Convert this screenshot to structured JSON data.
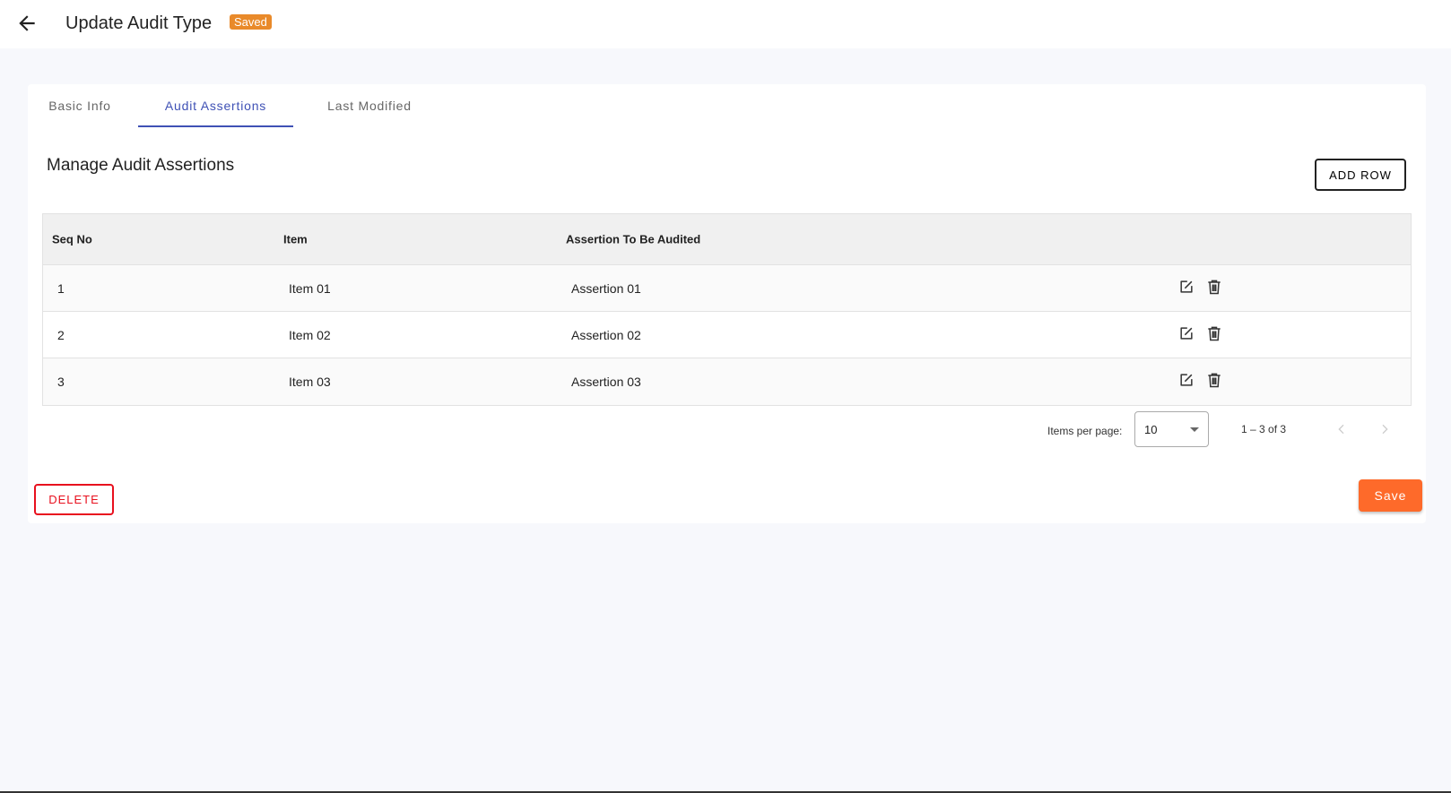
{
  "header": {
    "title": "Update Audit Type",
    "badge": "Saved"
  },
  "tabs": [
    {
      "label": "Basic Info"
    },
    {
      "label": "Audit Assertions",
      "active": true
    },
    {
      "label": "Last Modified"
    }
  ],
  "section": {
    "title": "Manage Audit Assertions",
    "add_row": "ADD ROW"
  },
  "table": {
    "columns": [
      "Seq No",
      "Item",
      "Assertion To Be Audited"
    ],
    "rows": [
      {
        "seq": "1",
        "item": "Item 01",
        "assertion": "Assertion 01"
      },
      {
        "seq": "2",
        "item": "Item 02",
        "assertion": "Assertion 02"
      },
      {
        "seq": "3",
        "item": "Item 03",
        "assertion": "Assertion 03"
      }
    ]
  },
  "paginator": {
    "label": "Items per page:",
    "page_size": "10",
    "range": "1 – 3 of 3"
  },
  "actions": {
    "delete": "DELETE",
    "save": "Save"
  },
  "colors": {
    "accent": "#3f51b5",
    "save": "#fe6a2a",
    "delete": "#e8101e",
    "badge": "#e98a2a"
  }
}
